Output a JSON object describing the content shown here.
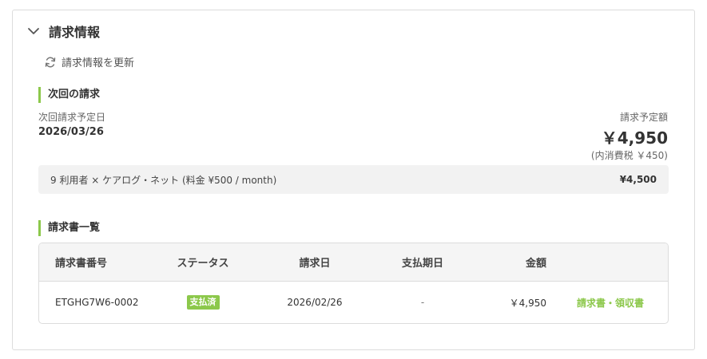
{
  "panel": {
    "title": "請求情報",
    "refresh_label": "請求情報を更新"
  },
  "next_billing": {
    "section_title": "次回の請求",
    "date_label": "次回請求予定日",
    "date_value": "2026/03/26",
    "amount_label": "請求予定額",
    "amount_value": "￥4,950",
    "tax_note": "(内消費税 ￥450)",
    "line_item": {
      "description": "9 利用者 × ケアログ・ネット (料金 ¥500 / month)",
      "price": "¥4,500"
    }
  },
  "invoices": {
    "section_title": "請求書一覧",
    "columns": [
      "請求書番号",
      "ステータス",
      "請求日",
      "支払期日",
      "金額"
    ],
    "rows": [
      {
        "number": "ETGHG7W6-0002",
        "status": "支払済",
        "invoice_date": "2026/02/26",
        "due_date": "-",
        "amount": "￥4,950",
        "doc_link": "請求書・領収書"
      }
    ]
  },
  "colors": {
    "accent": "#8cc84b",
    "border": "#dcdcdc",
    "row_bg": "#f2f2f2"
  },
  "icons": {
    "collapse": "chevron-down-icon",
    "refresh": "refresh-icon"
  }
}
